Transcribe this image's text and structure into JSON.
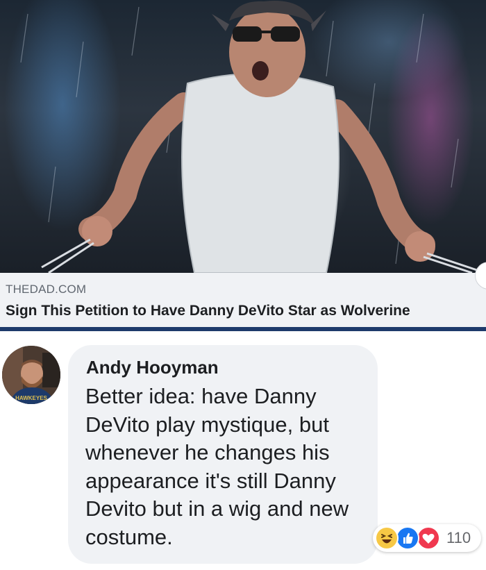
{
  "link_preview": {
    "domain": "THEDAD.COM",
    "title": "Sign This Petition to Have Danny DeVito Star as Wolverine"
  },
  "comment": {
    "author": "Andy Hooyman",
    "text": "Better idea: have Danny DeVito play mystique, but whenever he changes his appearance it's still Danny Devito but in a wig and new costume.",
    "reaction_count": "110",
    "reactions": [
      "haha-icon",
      "like-icon",
      "love-icon"
    ]
  },
  "colors": {
    "card_background": "#f0f2f5",
    "accent_bar": "#1e3a6b",
    "like_blue": "#1877f2",
    "love_red": "#f0384f",
    "haha_yellow": "#f7c845"
  }
}
